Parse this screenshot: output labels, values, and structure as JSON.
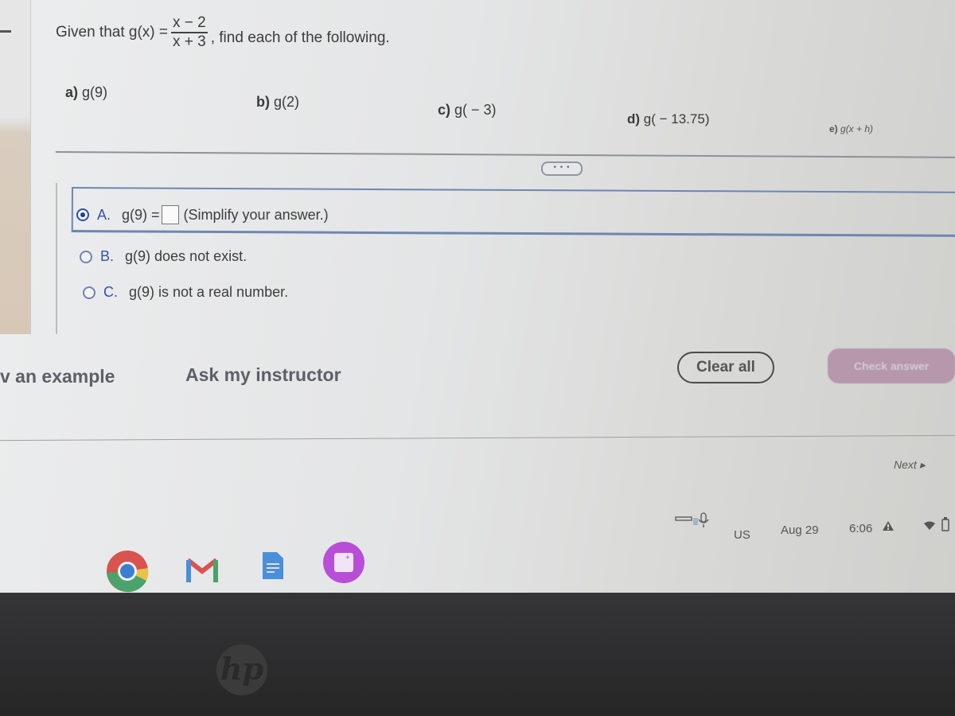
{
  "question": {
    "prefix": "Given that g(x) =",
    "fraction_numerator": "x − 2",
    "fraction_denominator": "x + 3",
    "suffix": ", find each of the following."
  },
  "parts": [
    {
      "label": "a)",
      "expr": "g(9)"
    },
    {
      "label": "b)",
      "expr": "g(2)"
    },
    {
      "label": "c)",
      "expr": "g( − 3)"
    },
    {
      "label": "d)",
      "expr": "g( − 13.75)"
    },
    {
      "label": "e)",
      "expr": "g(x + h)"
    }
  ],
  "more_button": "• • •",
  "options": [
    {
      "letter": "A.",
      "text_before": "g(9) =",
      "text_after": "(Simplify your answer.)",
      "selected": true,
      "answer_value": ""
    },
    {
      "letter": "B.",
      "text": "g(9) does not exist.",
      "selected": false
    },
    {
      "letter": "C.",
      "text": "g(9) is not a real number.",
      "selected": false
    }
  ],
  "actions": {
    "view_example": "v an example",
    "ask_instructor": "Ask my instructor",
    "clear_all": "Clear all",
    "check_answer": "Check answer",
    "next": "Next ▸"
  },
  "shelf": {
    "apps": [
      {
        "name": "Chrome",
        "icon": "chrome-icon"
      },
      {
        "name": "Gmail",
        "icon": "gmail-icon"
      },
      {
        "name": "Docs",
        "icon": "docs-icon"
      },
      {
        "name": "Screencast",
        "icon": "screencast-icon"
      }
    ],
    "input_method": "US",
    "date": "Aug 29",
    "time": "6:06"
  },
  "bezel_brand": "hp",
  "colors": {
    "accent_blue": "#3553a5",
    "check_button": "#b697ac",
    "text": "#3c3c3c"
  }
}
